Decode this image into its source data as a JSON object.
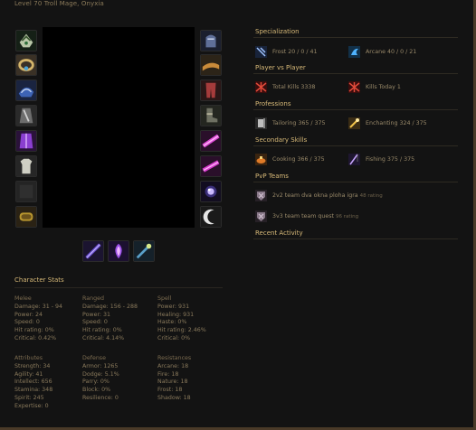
{
  "character": {
    "subtitle": "Level 70 Troll Mage, Onyxia"
  },
  "gear": {
    "left": [
      "head-helm-icon",
      "neck-amulet-icon",
      "shoulder-icon",
      "cloak-icon",
      "chest-robe-icon",
      "shirt-icon",
      "tabard-icon",
      "wrist-bracer-icon"
    ],
    "right": [
      "gloves-icon",
      "belt-icon",
      "legs-icon",
      "boots-icon",
      "ring-icon",
      "ring-icon",
      "trinket-orb-icon",
      "trinket-crescent-icon"
    ],
    "weapons": [
      "main-hand-staff-icon",
      "off-hand-icon",
      "wand-icon"
    ]
  },
  "stats": {
    "title": "Character Stats",
    "melee": {
      "header": "Melee",
      "lines": [
        "Damage: 31 - 94",
        "Power: 24",
        "Speed: 0",
        "Hit rating: 0%",
        "Critical: 0.42%"
      ]
    },
    "ranged": {
      "header": "Ranged",
      "lines": [
        "Damage: 156 - 288",
        "Power: 31",
        "Speed: 0",
        "Hit rating: 0%",
        "Critical: 4.14%"
      ]
    },
    "spell": {
      "header": "Spell",
      "lines": [
        "Power: 931",
        "Healing: 931",
        "Haste: 0%",
        "Hit rating: 2.46%",
        "Critical: 0%"
      ]
    },
    "attributes": {
      "header": "Attributes",
      "lines": [
        "Strength: 34",
        "Agility: 41",
        "Intellect: 656",
        "Stamina: 348",
        "Spirit: 245",
        "Expertise: 0"
      ]
    },
    "defense": {
      "header": "Defense",
      "lines": [
        "Armor: 1265",
        "Dodge: 5.1%",
        "Parry: 0%",
        "Block: 0%",
        "Resilience: 0"
      ]
    },
    "resistances": {
      "header": "Resistances",
      "lines": [
        "Arcane: 18",
        "Fire: 18",
        "Nature: 18",
        "Frost: 18",
        "Shadow: 18"
      ]
    }
  },
  "specialization": {
    "title": "Specialization",
    "frost": "Frost 20 / 0 / 41",
    "arcane": "Arcane 40 / 0 / 21"
  },
  "pvp": {
    "title": "Player vs Player",
    "total_kills": "Total Kills 3338",
    "kills_today": "Kills Today 1"
  },
  "professions": {
    "title": "Professions",
    "tailoring": "Tailoring 365 / 375",
    "enchanting": "Enchanting 324 / 375"
  },
  "secondary": {
    "title": "Secondary Skills",
    "cooking": "Cooking 366 / 375",
    "fishing": "Fishing 375 / 375"
  },
  "pvp_teams": {
    "title": "PvP Teams",
    "team2v2": "2v2 team dva okna ploha igra",
    "team2v2_rating": "48 rating",
    "team3v3": "3v3 team team quest",
    "team3v3_rating": "96 rating"
  },
  "recent": {
    "title": "Recent Activity"
  },
  "colors": {
    "accent": "#d7b978",
    "text": "#9a8a6a",
    "background": "#131313"
  }
}
